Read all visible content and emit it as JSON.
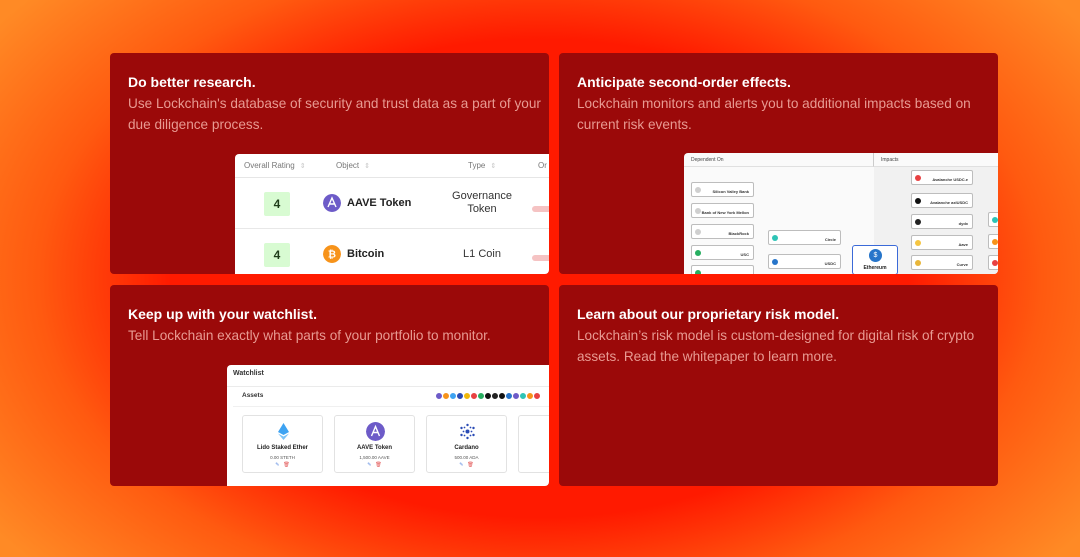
{
  "cards": [
    {
      "title": "Do better research.",
      "body": "Use Lockchain's database of security and trust data as a part of your due diligence process."
    },
    {
      "title": "Anticipate second-order effects.",
      "body": "Lockchain monitors and alerts you to additional impacts based on current risk events."
    },
    {
      "title": "Keep up with your watchlist.",
      "body": "Tell Lockchain exactly what parts of your portfolio to monitor."
    },
    {
      "title": "Learn about our proprietary risk model.",
      "body": "Lockchain’s risk model is custom-designed for digital risk of crypto assets. Read the whitepaper to learn more."
    }
  ],
  "research_table": {
    "headers": [
      "Overall Rating",
      "Object",
      "Type",
      "Or"
    ],
    "rows": [
      {
        "rating": "4",
        "object": "AAVE Token",
        "type": "Governance Token",
        "icon": "aave-icon"
      },
      {
        "rating": "4",
        "object": "Bitcoin",
        "type": "L1 Coin",
        "icon": "bitcoin-icon"
      }
    ]
  },
  "graph": {
    "dependent_on_label": "Dependent On",
    "impacts_label": "Impacts",
    "left_nodes": [
      "Silicon Valley Bank",
      "Bank of New York Mellon",
      "BlackRock",
      "USC",
      ""
    ],
    "mid_nodes": [
      "Circle",
      "USDC"
    ],
    "center_node": "Ethereum",
    "right_nodes": [
      "Avalanche USDC.e",
      "Avalanche axlUSDC",
      "dydx",
      "Aave",
      "Curve"
    ]
  },
  "watchlist": {
    "title": "Watchlist",
    "assets_label": "Assets",
    "assets": [
      {
        "name": "Lido Staked Ether",
        "balance": "0.00 STETH",
        "icon": "lido-icon",
        "color": "#3ea3f2"
      },
      {
        "name": "AAVE Token",
        "balance": "1,500.00 AAVE",
        "icon": "aave-icon",
        "color": "#6d5bc8"
      },
      {
        "name": "Cardano",
        "balance": "500.00 ADA",
        "icon": "cardano-icon",
        "color": "#2a4bb5"
      }
    ],
    "edit_icon": "edit-icon",
    "delete_icon": "trash-icon"
  },
  "colors": {
    "card_bg": "#9b0909",
    "card_text": "#e89a92",
    "rating_bg": "#d8fbd2"
  }
}
